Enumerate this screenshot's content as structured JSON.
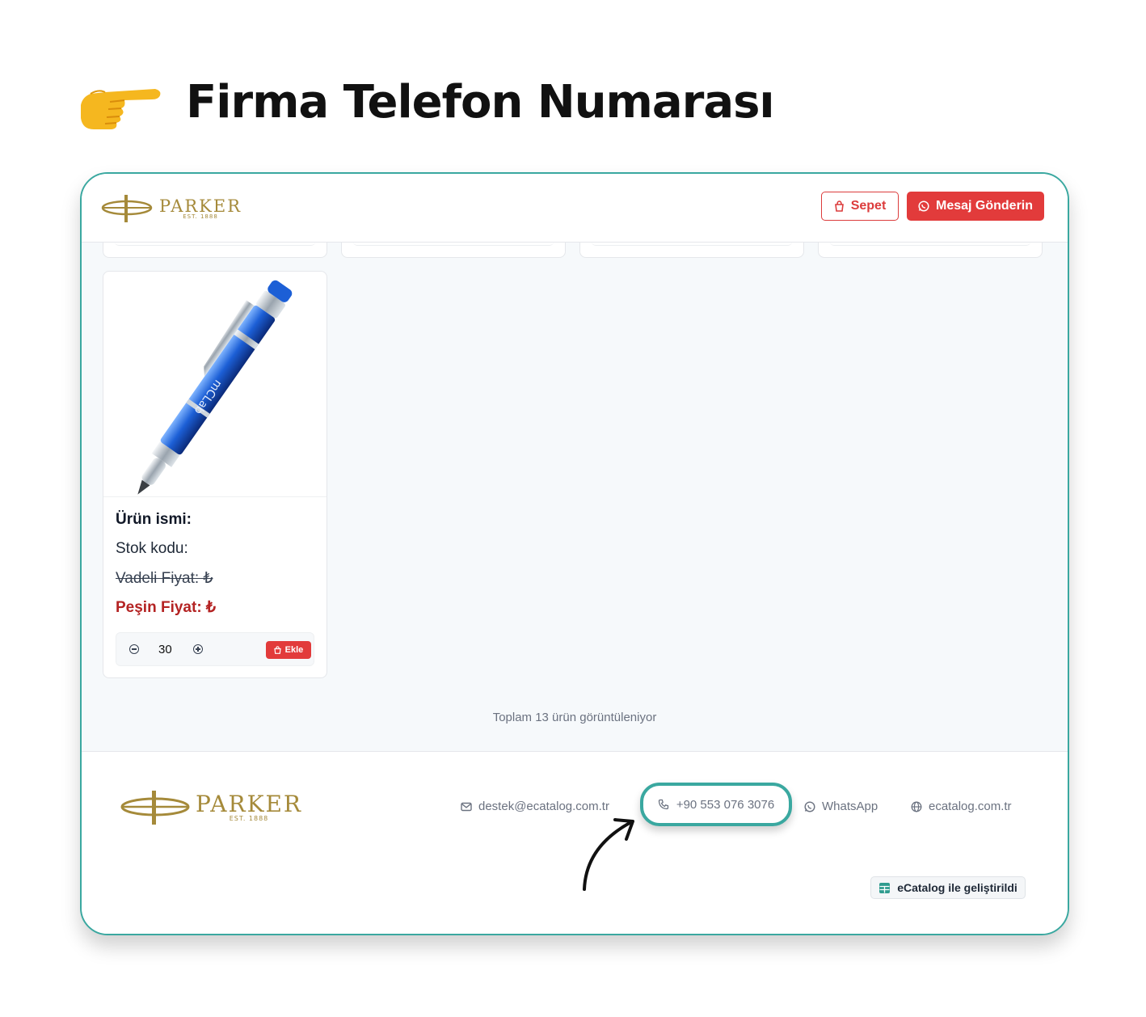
{
  "heading": {
    "title": "Firma Telefon Numarası"
  },
  "brand": {
    "name": "PARKER",
    "est": "EST. 1888"
  },
  "header": {
    "cart_label": "Sepet",
    "message_label": "Mesaj Gönderin"
  },
  "product": {
    "name_label": "Ürün ismi:",
    "stock_label": "Stok kodu:",
    "deferred_price_label": "Vadeli Fiyat: ₺",
    "cash_price_label": "Peşin Fiyat: ₺",
    "quantity": "30",
    "add_label": "Ekle",
    "engraving": "mCLab"
  },
  "summary": {
    "total_text": "Toplam 13 ürün görüntüleniyor"
  },
  "footer": {
    "email": "destek@ecatalog.com.tr",
    "phone": "+90 553 076 3076",
    "whatsapp": "WhatsApp",
    "website": "ecatalog.com.tr",
    "credit": "eCatalog ile geliştirildi"
  },
  "colors": {
    "accent": "#3aa8a0",
    "danger": "#e23b3b",
    "price": "#b42323",
    "brand_gold": "#a58a3a"
  },
  "icons": [
    "pointing-hand-icon",
    "bag-icon",
    "whatsapp-icon",
    "mail-icon",
    "phone-icon",
    "globe-icon",
    "grid-icon",
    "minus-icon",
    "plus-icon",
    "arrow-icon"
  ]
}
